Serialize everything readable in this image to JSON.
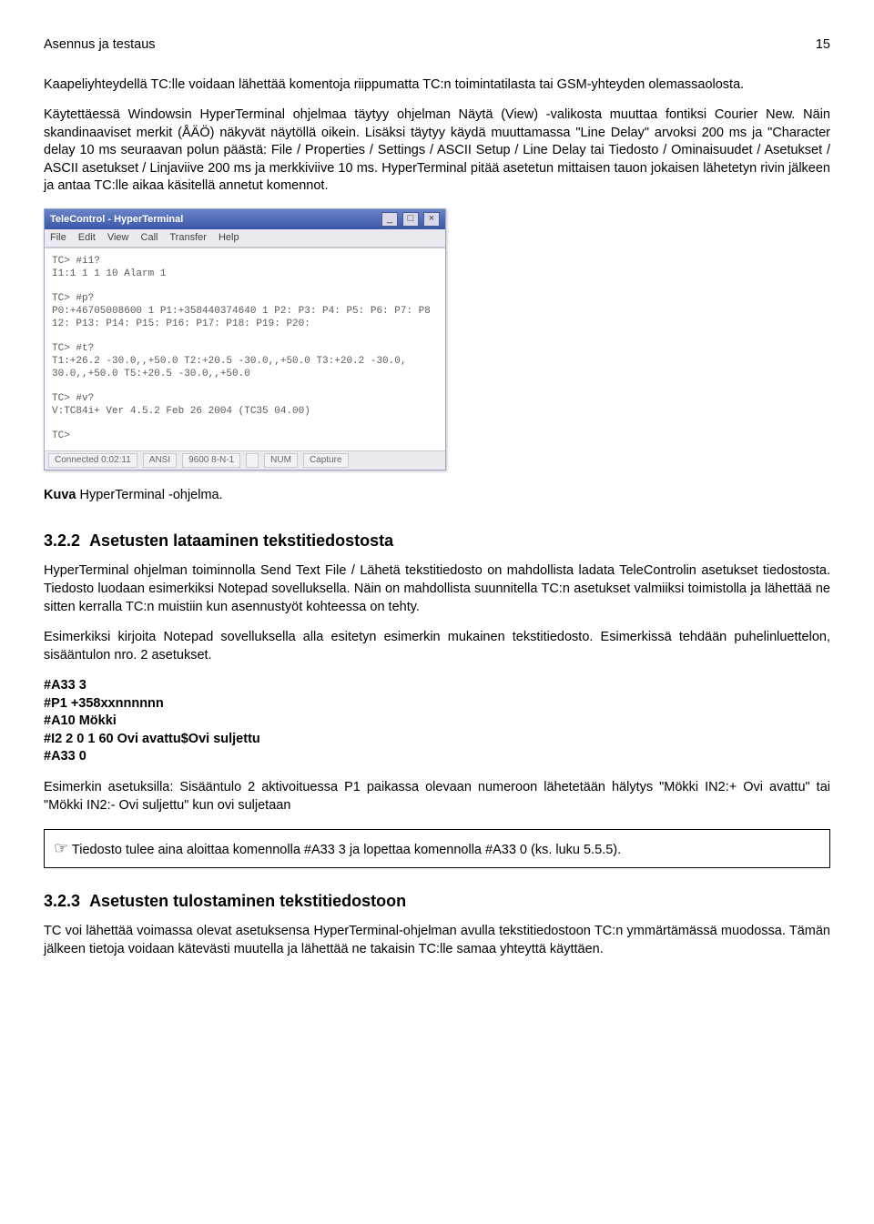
{
  "header": {
    "left": "Asennus ja testaus",
    "right": "15"
  },
  "p1": "Kaapeliyhteydellä TC:lle voidaan lähettää komentoja riippumatta TC:n toimintatilasta tai GSM-yhteyden olemassaolosta.",
  "p2": "Käytettäessä Windowsin HyperTerminal ohjelmaa täytyy ohjelman Näytä (View) -valikosta muuttaa fontiksi Courier New. Näin skandinaaviset merkit (ÅÄÖ) näkyvät näytöllä oikein. Lisäksi täytyy käydä muuttamassa \"Line Delay\" arvoksi 200 ms ja \"Character delay 10 ms seuraavan polun päästä: File / Properties / Settings / ASCII Setup / Line Delay tai Tiedosto / Ominaisuudet / Asetukset / ASCII asetukset / Linjaviive 200 ms ja merkkiviive 10 ms. HyperTerminal pitää asetetun mittaisen tauon jokaisen lähetetyn rivin jälkeen ja antaa TC:lle aikaa käsitellä annetut komennot.",
  "terminal": {
    "title": "TeleControl - HyperTerminal",
    "menus": [
      "File",
      "Edit",
      "View",
      "Call",
      "Transfer",
      "Help"
    ],
    "body": "TC> #i1?\nI1:1 1 1 10 Alarm 1\n\nTC> #p?\nP0:+46705008600 1 P1:+358440374640 1 P2: P3: P4: P5: P6: P7: P8\n12: P13: P14: P15: P16: P17: P18: P19: P20:\n\nTC> #t?\nT1:+26.2 -30.0,,+50.0 T2:+20.5 -30.0,,+50.0 T3:+20.2 -30.0,\n30.0,,+50.0 T5:+20.5 -30.0,,+50.0\n\nTC> #v?\nV:TC84i+ Ver 4.5.2 Feb 26 2004 (TC35 04.00)\n\nTC>",
    "status": [
      "Connected 0:02:11",
      "ANSI",
      "9600 8-N-1",
      "",
      "NUM",
      "Capture"
    ]
  },
  "caption": {
    "lead": "Kuva",
    "rest": "  HyperTerminal -ohjelma."
  },
  "s322": {
    "num": "3.2.2",
    "title": "Asetusten lataaminen tekstitiedostosta",
    "p1": "HyperTerminal ohjelman toiminnolla  Send Text File / Lähetä tekstitiedosto on mahdollista ladata TeleControlin asetukset tiedostosta. Tiedosto luodaan esimerkiksi Notepad sovelluksella.  Näin on mahdollista suunnitella TC:n asetukset valmiiksi toimistolla ja lähettää ne sitten kerralla TC:n muistiin kun asennustyöt kohteessa on tehty.",
    "p2": "Esimerkiksi kirjoita Notepad sovelluksella alla esitetyn esimerkin mukainen tekstitiedosto. Esimerkissä tehdään puhelinluettelon, sisääntulon nro. 2 asetukset.",
    "cmds": [
      "#A33 3",
      "#P1 +358xxnnnnnn",
      "#A10 Mökki",
      "#I2 2 0 1 60 Ovi avattu$Ovi suljettu",
      "#A33 0"
    ],
    "p3": "Esimerkin asetuksilla: Sisääntulo 2 aktivoituessa P1 paikassa olevaan numeroon lähetetään hälytys \"Mökki IN2:+ Ovi avattu\" tai \"Mökki IN2:- Ovi suljettu\" kun ovi suljetaan",
    "note": "Tiedosto tulee aina aloittaa komennolla #A33 3  ja lopettaa komennolla #A33 0  (ks. luku 5.5.5)."
  },
  "s323": {
    "num": "3.2.3",
    "title": "Asetusten tulostaminen tekstitiedostoon",
    "p1": "TC voi lähettää voimassa olevat asetuksensa HyperTerminal-ohjelman avulla tekstitiedostoon TC:n ymmärtämässä muodossa. Tämän jälkeen tietoja voidaan kätevästi muutella ja lähettää ne takaisin TC:lle samaa yhteyttä käyttäen."
  },
  "icons": {
    "finger": "☞"
  }
}
